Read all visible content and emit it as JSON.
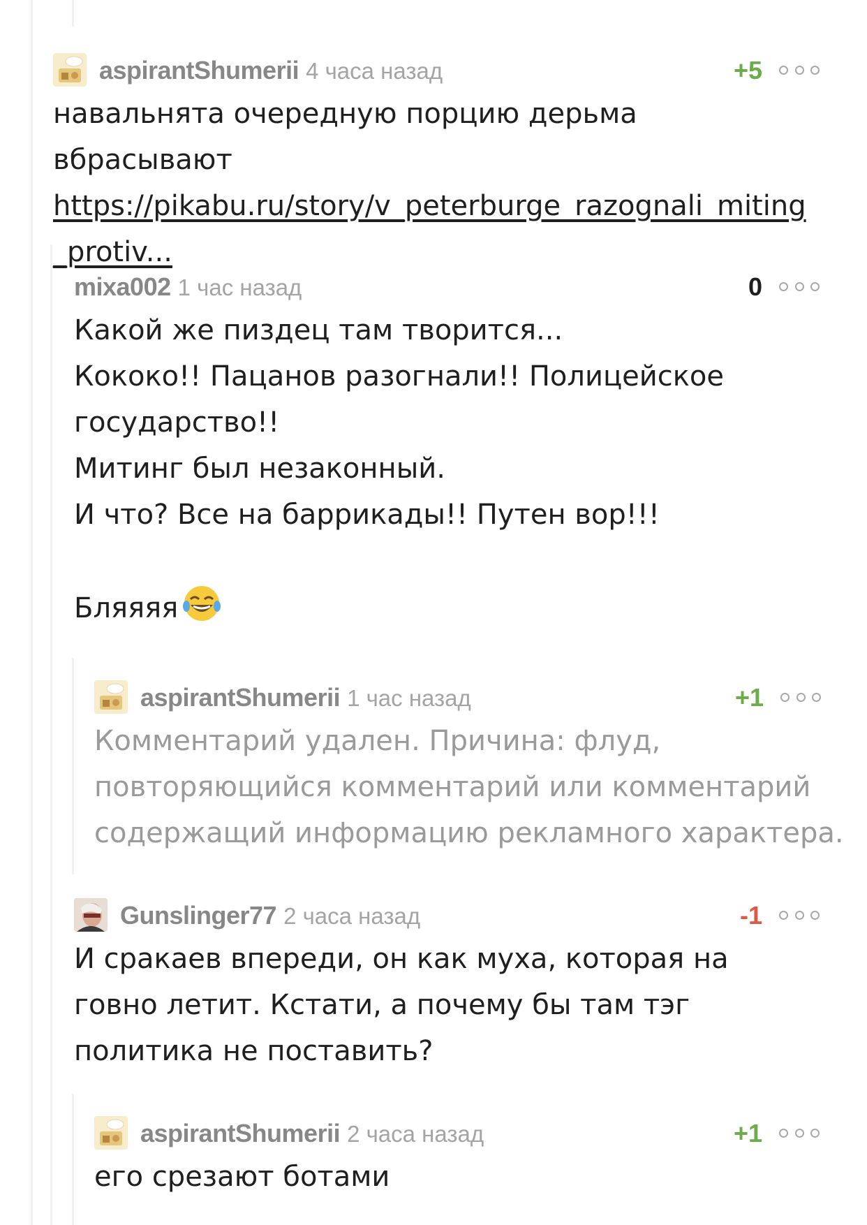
{
  "thread": {
    "comments": [
      {
        "author": "aspirantShumerii",
        "time": "4 часа назад",
        "rating": "+5",
        "text": "навальнята очередную порцию дерьма вбрасывают",
        "link": "https://pikabu.ru/story/v_peterburge_razognali_miting_protiv..."
      },
      {
        "author": "mixa002",
        "time": "1 час назад",
        "rating": "0",
        "text": "Какой же пиздец там творится...\nКококо!! Пацанов разогнали!! Полицейское государство!!\nМитинг был незаконный.\nИ что? Все на баррикады!! Путен вор!!!\n\nБляяяя",
        "emoji": "tears-of-joy-emoji"
      },
      {
        "author": "aspirantShumerii",
        "time": "1 час назад",
        "rating": "+1",
        "text": "Комментарий удален. Причина: флуд, повторяющийся комментарий или комментарий содержащий информацию рекламного характера."
      },
      {
        "author": "Gunslinger77",
        "time": "2 часа назад",
        "rating": "-1",
        "text": "И сракаев впереди, он как муха, которая на говно летит. Кстати, а почему бы там тэг политика не поставить?"
      },
      {
        "author": "aspirantShumerii",
        "time": "2 часа назад",
        "rating": "+1",
        "text": "его срезают ботами"
      }
    ]
  },
  "colors": {
    "rating_positive": "#6dab4d",
    "rating_negative": "#d95a47",
    "author": "#878787",
    "time": "#a4a4a4",
    "deleted_text": "#9a9a9a",
    "thread_line": "#f1f1f1"
  }
}
